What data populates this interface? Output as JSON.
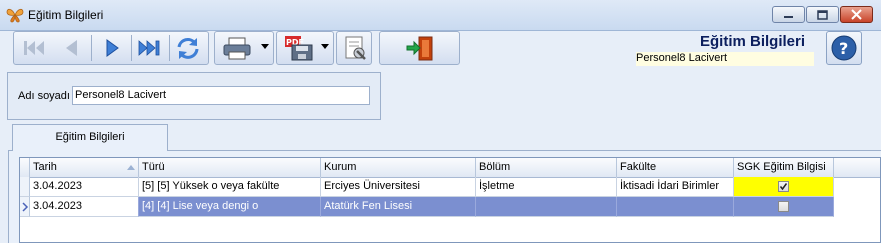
{
  "window": {
    "title": "Eğitim Bilgileri",
    "icon": "butterfly-icon",
    "controls": [
      "minimize-icon",
      "maximize-icon",
      "close-icon"
    ]
  },
  "toolbar": {
    "nav_buttons": [
      "first-record-icon",
      "previous-record-icon",
      "next-record-icon",
      "last-record-icon",
      "refresh-icon"
    ],
    "action_buttons": [
      "print-icon",
      "pdf-export-icon",
      "settings-icon",
      "exit-door-icon"
    ]
  },
  "header": {
    "form_title": "Eğitim Bilgileri",
    "user_name": "Personel8 Lacivert",
    "help_icon": "help-icon"
  },
  "filter": {
    "name_label": "Adı soyadı",
    "name_value": "Personel8 Lacivert"
  },
  "tabs": [
    {
      "label": "Eğitim Bilgileri",
      "active": true
    }
  ],
  "grid": {
    "columns": [
      "Tarih",
      "Türü",
      "Kurum",
      "Bölüm",
      "Fakülte",
      "SGK Eğitim Bilgisi"
    ],
    "sorted_column": "Tarih",
    "rows": [
      {
        "tarih": "3.04.2023",
        "turu": "[5] [5] Yüksek o veya fakülte",
        "kurum": "Erciyes Üniversitesi",
        "bolum": "İşletme",
        "fakulte": "İktisadi İdari Birimler",
        "sgk": true,
        "selected": false
      },
      {
        "tarih": "3.04.2023",
        "turu": "[4] [4] Lise veya dengi o",
        "kurum": "Atatürk Fen Lisesi",
        "bolum": "",
        "fakulte": "",
        "sgk": false,
        "selected": true
      }
    ]
  },
  "colors": {
    "selected_row": "#7b8fd0",
    "sgk_highlight": "#ffff00",
    "title_text": "#0c1f5e"
  }
}
